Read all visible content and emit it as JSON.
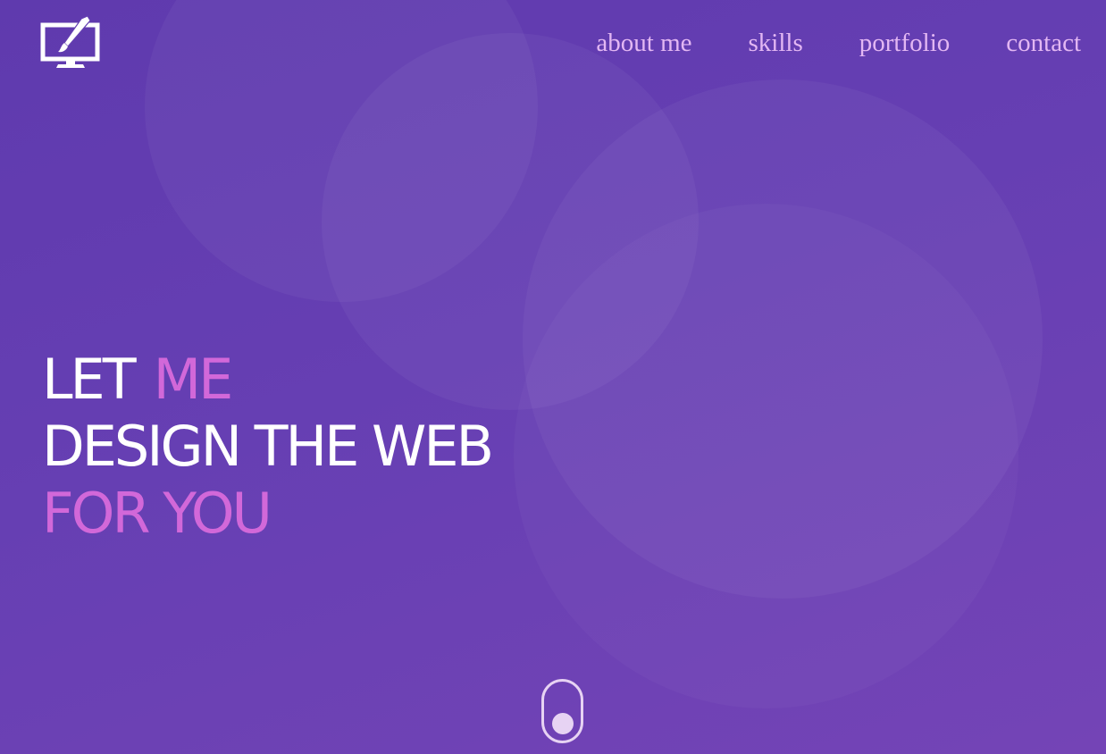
{
  "brand": {
    "logo_icon": "monitor-paintbrush-icon"
  },
  "nav": {
    "items": [
      {
        "label": "about me"
      },
      {
        "label": "skills"
      },
      {
        "label": "portfolio"
      },
      {
        "label": "contact"
      }
    ]
  },
  "hero": {
    "line1_word1": "LET",
    "line1_word2": "ME",
    "line2": "DESIGN THE WEB",
    "line3": "FOR YOU"
  },
  "scroll": {
    "icon": "scroll-mouse-icon"
  },
  "colors": {
    "background": "#663fb3",
    "accent": "#d268d9",
    "nav_text": "#e3b7f3",
    "heading_text": "#ffffff"
  }
}
